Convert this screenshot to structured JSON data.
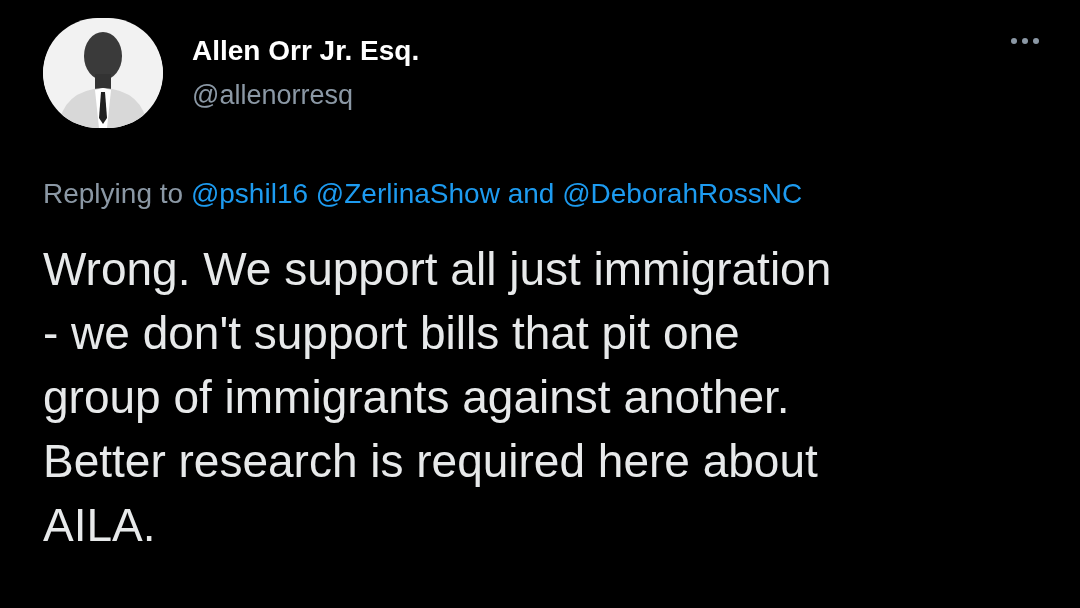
{
  "author": {
    "name": "Allen Orr Jr. Esq.",
    "handle": "@allenorresq"
  },
  "reply_line": {
    "prefix": "Replying to",
    "parts": [
      {
        "kind": "mention",
        "text": "@pshil16"
      },
      {
        "kind": "mention",
        "text": "@ZerlinaShow"
      },
      {
        "kind": "word",
        "text": "and"
      },
      {
        "kind": "mention",
        "text": "@DeborahRossNC"
      }
    ]
  },
  "body_lines": [
    "Wrong. We support all just immigration",
    "- we don't support bills that pit one",
    "group of immigrants against another.",
    "Better research is required here about",
    "AILA."
  ]
}
